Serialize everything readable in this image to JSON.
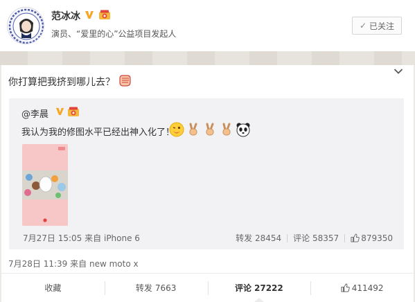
{
  "user": {
    "name": "范冰冰",
    "description": "演员、“爱里的心”公益项目发起人",
    "follow_label": "已关注"
  },
  "post": {
    "text": "你打算把我挤到哪儿去？",
    "timestamp": "7月28日 11:39",
    "source_prefix": "来自",
    "source": "new moto x"
  },
  "repost": {
    "author": "@李晨",
    "text": "我认为我的修图水平已经出神入化了！",
    "timestamp": "7月27日 15:05",
    "source_prefix": "来自",
    "source": "iPhone 6",
    "forward_label": "转发",
    "forward_count": "28454",
    "comment_label": "评论",
    "comment_count": "58357",
    "like_count": "879350"
  },
  "actions": {
    "collect_label": "收藏",
    "forward_label": "转发",
    "forward_count": "7663",
    "comment_label": "评论",
    "comment_count": "27222",
    "like_count": "411492"
  },
  "colors": {
    "verified_badge": "#f5a623",
    "card_bg": "#ffffff",
    "repost_bg": "#f2f2f5",
    "thumbnail_bg": "#f7c7c8"
  }
}
